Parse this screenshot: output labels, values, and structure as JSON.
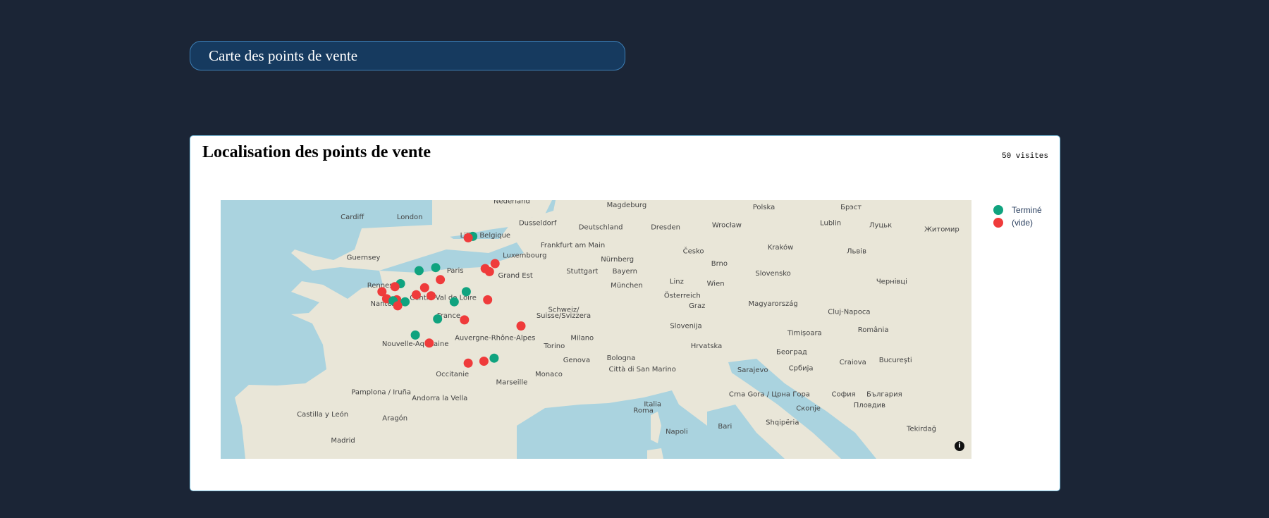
{
  "header": {
    "title": "Carte des points de vente"
  },
  "card": {
    "title": "Localisation des points de vente",
    "count_label": "50 visites"
  },
  "legend": [
    {
      "label": "Terminé",
      "color": "#10a37f"
    },
    {
      "label": "(vide)",
      "color": "#ef3b3b"
    }
  ],
  "map": {
    "info_icon": "i",
    "place_labels": [
      {
        "text": "Nederland",
        "lon": 5.4,
        "lat": 52.3
      },
      {
        "text": "Magdeburg",
        "lon": 11.6,
        "lat": 52.1
      },
      {
        "text": "Polska",
        "lon": 19.0,
        "lat": 52.0
      },
      {
        "text": "Брэст",
        "lon": 23.7,
        "lat": 52.0
      },
      {
        "text": "Cardiff",
        "lon": -3.2,
        "lat": 51.5
      },
      {
        "text": "London",
        "lon": -0.1,
        "lat": 51.5
      },
      {
        "text": "Dusseldorf",
        "lon": 6.8,
        "lat": 51.2
      },
      {
        "text": "Deutschland",
        "lon": 10.2,
        "lat": 51.0
      },
      {
        "text": "Lublin",
        "lon": 22.6,
        "lat": 51.2
      },
      {
        "text": "Луцьк",
        "lon": 25.3,
        "lat": 51.1
      },
      {
        "text": "Wrocław",
        "lon": 17.0,
        "lat": 51.1
      },
      {
        "text": "Житомир",
        "lon": 28.6,
        "lat": 50.9
      },
      {
        "text": "Belgique",
        "lon": 4.5,
        "lat": 50.6
      },
      {
        "text": "Frankfurt am Main",
        "lon": 8.7,
        "lat": 50.1
      },
      {
        "text": "Dresden",
        "lon": 13.7,
        "lat": 51.0
      },
      {
        "text": "Kraków",
        "lon": 19.9,
        "lat": 50.0
      },
      {
        "text": "Lille",
        "lon": 3.0,
        "lat": 50.6
      },
      {
        "text": "Guernsey",
        "lon": -2.6,
        "lat": 49.5
      },
      {
        "text": "Luxembourg",
        "lon": 6.1,
        "lat": 49.6
      },
      {
        "text": "Nürnberg",
        "lon": 11.1,
        "lat": 49.4
      },
      {
        "text": "Česko",
        "lon": 15.2,
        "lat": 49.8
      },
      {
        "text": "Львів",
        "lon": 24.0,
        "lat": 49.8
      },
      {
        "text": "Paris",
        "lon": 2.35,
        "lat": 48.85
      },
      {
        "text": "Grand Est",
        "lon": 5.6,
        "lat": 48.6
      },
      {
        "text": "Bayern",
        "lon": 11.5,
        "lat": 48.8
      },
      {
        "text": "Brno",
        "lon": 16.6,
        "lat": 49.2
      },
      {
        "text": "Stuttgart",
        "lon": 9.2,
        "lat": 48.8
      },
      {
        "text": "Linz",
        "lon": 14.3,
        "lat": 48.3
      },
      {
        "text": "Wien",
        "lon": 16.4,
        "lat": 48.2
      },
      {
        "text": "Slovensko",
        "lon": 19.5,
        "lat": 48.7
      },
      {
        "text": "Rennes",
        "lon": -1.7,
        "lat": 48.1
      },
      {
        "text": "Centre-Val de Loire",
        "lon": 1.7,
        "lat": 47.5
      },
      {
        "text": "München",
        "lon": 11.6,
        "lat": 48.1
      },
      {
        "text": "Österreich",
        "lon": 14.6,
        "lat": 47.6
      },
      {
        "text": "Чернівці",
        "lon": 25.9,
        "lat": 48.3
      },
      {
        "text": "Nantes",
        "lon": -1.55,
        "lat": 47.2
      },
      {
        "text": "Schweiz/",
        "lon": 8.2,
        "lat": 46.9
      },
      {
        "text": "Suisse/Svizzera",
        "lon": 8.2,
        "lat": 46.6
      },
      {
        "text": "Magyarország",
        "lon": 19.5,
        "lat": 47.2
      },
      {
        "text": "France",
        "lon": 2.0,
        "lat": 46.6
      },
      {
        "text": "Graz",
        "lon": 15.4,
        "lat": 47.1
      },
      {
        "text": "Cluj-Napoca",
        "lon": 23.6,
        "lat": 46.8
      },
      {
        "text": "Slovenija",
        "lon": 14.8,
        "lat": 46.1
      },
      {
        "text": "Milano",
        "lon": 9.2,
        "lat": 45.5
      },
      {
        "text": "Auvergne-Rhône-Alpes",
        "lon": 4.5,
        "lat": 45.5
      },
      {
        "text": "Timișoara",
        "lon": 21.2,
        "lat": 45.75
      },
      {
        "text": "România",
        "lon": 24.9,
        "lat": 45.9
      },
      {
        "text": "Torino",
        "lon": 7.7,
        "lat": 45.1
      },
      {
        "text": "Београд",
        "lon": 20.5,
        "lat": 44.8
      },
      {
        "text": "Nouvelle-Aquitaine",
        "lon": 0.2,
        "lat": 45.2
      },
      {
        "text": "Genova",
        "lon": 8.9,
        "lat": 44.4
      },
      {
        "text": "Bologna",
        "lon": 11.3,
        "lat": 44.5
      },
      {
        "text": "Hrvatska",
        "lon": 15.9,
        "lat": 45.1
      },
      {
        "text": "Sarajevo",
        "lon": 18.4,
        "lat": 43.9
      },
      {
        "text": "Србија",
        "lon": 21.0,
        "lat": 44.0
      },
      {
        "text": "Craiova",
        "lon": 23.8,
        "lat": 44.3
      },
      {
        "text": "București",
        "lon": 26.1,
        "lat": 44.4
      },
      {
        "text": "Monaco",
        "lon": 7.4,
        "lat": 43.7
      },
      {
        "text": "Occitanie",
        "lon": 2.2,
        "lat": 43.7
      },
      {
        "text": "Città di San Marino",
        "lon": 12.45,
        "lat": 43.94
      },
      {
        "text": "Pamplona / Iruña",
        "lon": -1.64,
        "lat": 42.8
      },
      {
        "text": "Marseille",
        "lon": 5.4,
        "lat": 43.3
      },
      {
        "text": "Crna Gora / Црна Гора",
        "lon": 19.3,
        "lat": 42.7
      },
      {
        "text": "София",
        "lon": 23.3,
        "lat": 42.7
      },
      {
        "text": "България",
        "lon": 25.5,
        "lat": 42.7
      },
      {
        "text": "Andorra la Vella",
        "lon": 1.52,
        "lat": 42.5
      },
      {
        "text": "Castilla y León",
        "lon": -4.8,
        "lat": 41.7
      },
      {
        "text": "Aragón",
        "lon": -0.9,
        "lat": 41.5
      },
      {
        "text": "Roma",
        "lon": 12.5,
        "lat": 41.9
      },
      {
        "text": "Italia",
        "lon": 13.0,
        "lat": 42.2
      },
      {
        "text": "Скопје",
        "lon": 21.4,
        "lat": 42.0
      },
      {
        "text": "Пловдив",
        "lon": 24.7,
        "lat": 42.15
      },
      {
        "text": "Shqipëria",
        "lon": 20.0,
        "lat": 41.3
      },
      {
        "text": "Bari",
        "lon": 16.9,
        "lat": 41.1
      },
      {
        "text": "Madrid",
        "lon": -3.7,
        "lat": 40.4
      },
      {
        "text": "Napoli",
        "lon": 14.3,
        "lat": 40.85
      },
      {
        "text": "Tekirdağ",
        "lon": 27.5,
        "lat": 40.98
      }
    ],
    "markers": [
      {
        "lon": 3.3,
        "lat": 50.65,
        "status": "Terminé"
      },
      {
        "lon": 3.05,
        "lat": 50.58,
        "status": "(vide)"
      },
      {
        "lon": 4.5,
        "lat": 49.3,
        "status": "(vide)"
      },
      {
        "lon": 3.97,
        "lat": 49.05,
        "status": "(vide)"
      },
      {
        "lon": 4.2,
        "lat": 48.9,
        "status": "(vide)"
      },
      {
        "lon": 1.3,
        "lat": 49.1,
        "status": "Terminé"
      },
      {
        "lon": 0.4,
        "lat": 48.95,
        "status": "Terminé"
      },
      {
        "lon": 1.55,
        "lat": 48.5,
        "status": "(vide)"
      },
      {
        "lon": -0.6,
        "lat": 48.3,
        "status": "Terminé"
      },
      {
        "lon": -0.9,
        "lat": 48.15,
        "status": "(vide)"
      },
      {
        "lon": 0.7,
        "lat": 48.1,
        "status": "(vide)"
      },
      {
        "lon": 2.95,
        "lat": 47.9,
        "status": "Terminé"
      },
      {
        "lon": -1.6,
        "lat": 47.9,
        "status": "(vide)"
      },
      {
        "lon": 0.25,
        "lat": 47.75,
        "status": "(vide)"
      },
      {
        "lon": 1.05,
        "lat": 47.7,
        "status": "(vide)"
      },
      {
        "lon": 4.1,
        "lat": 47.5,
        "status": "(vide)"
      },
      {
        "lon": -1.35,
        "lat": 47.55,
        "status": "(vide)"
      },
      {
        "lon": -0.8,
        "lat": 47.5,
        "status": "(vide)"
      },
      {
        "lon": -1.0,
        "lat": 47.45,
        "status": "Terminé"
      },
      {
        "lon": -0.35,
        "lat": 47.4,
        "status": "Terminé"
      },
      {
        "lon": 2.3,
        "lat": 47.4,
        "status": "Terminé"
      },
      {
        "lon": -0.75,
        "lat": 47.2,
        "status": "(vide)"
      },
      {
        "lon": 1.4,
        "lat": 46.55,
        "status": "Terminé"
      },
      {
        "lon": 2.85,
        "lat": 46.5,
        "status": "(vide)"
      },
      {
        "lon": 5.9,
        "lat": 46.2,
        "status": "(vide)"
      },
      {
        "lon": 0.2,
        "lat": 45.75,
        "status": "Terminé"
      },
      {
        "lon": 0.95,
        "lat": 45.35,
        "status": "(vide)"
      },
      {
        "lon": 4.45,
        "lat": 44.6,
        "status": "Terminé"
      },
      {
        "lon": 3.9,
        "lat": 44.45,
        "status": "(vide)"
      },
      {
        "lon": 3.05,
        "lat": 44.35,
        "status": "(vide)"
      }
    ]
  }
}
